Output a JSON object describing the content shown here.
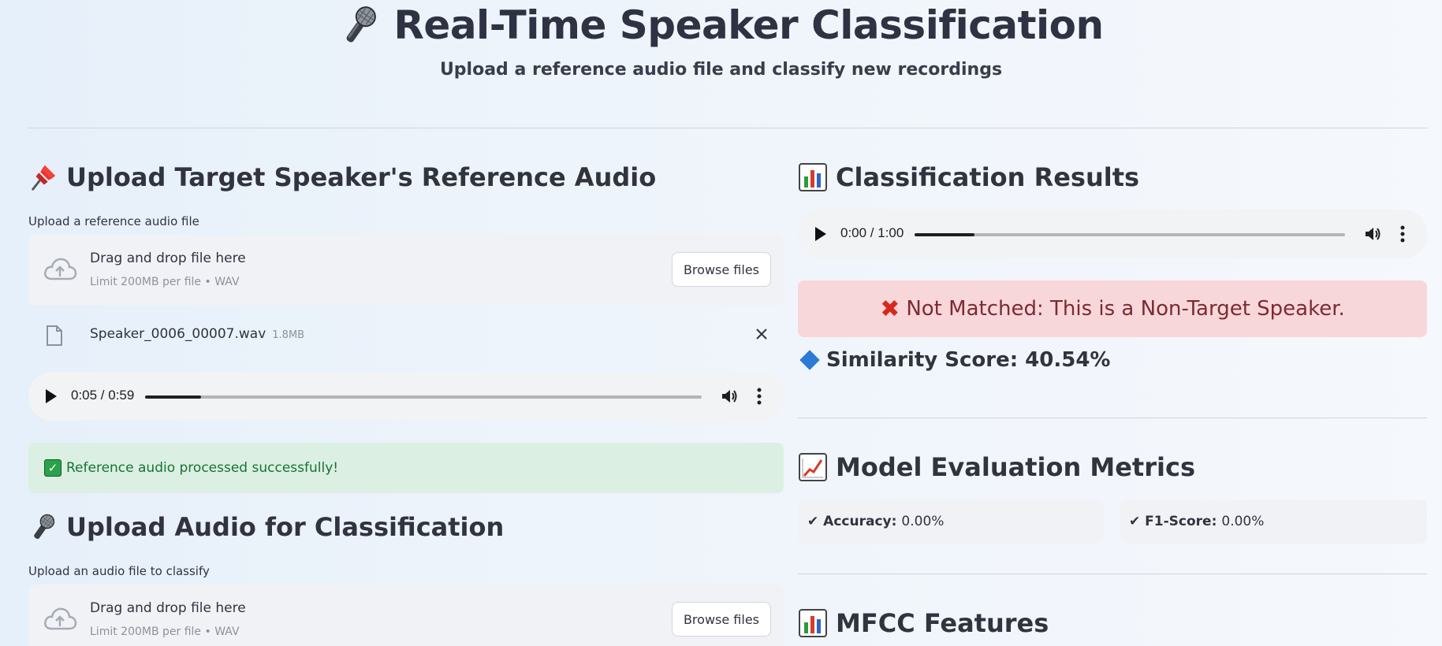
{
  "header": {
    "title": "Real-Time Speaker Classification",
    "subtitle": "Upload a reference audio file and classify new recordings"
  },
  "reference": {
    "heading": "Upload Target Speaker's Reference Audio",
    "label": "Upload a reference audio file",
    "dropzone": {
      "title": "Drag and drop file here",
      "limit": "Limit 200MB per file • WAV",
      "browse": "Browse files"
    },
    "file": {
      "name": "Speaker_0006_00007.wav",
      "size": "1.8MB"
    },
    "player": {
      "time": "0:05 / 0:59",
      "progress": 0.1
    },
    "success": "Reference audio processed successfully!"
  },
  "classify": {
    "heading": "Upload Audio for Classification",
    "label": "Upload an audio file to classify",
    "dropzone": {
      "title": "Drag and drop file here",
      "limit": "Limit 200MB per file • WAV",
      "browse": "Browse files"
    }
  },
  "results": {
    "heading": "Classification Results",
    "player": {
      "time": "0:00 / 1:00",
      "progress": 0.14
    },
    "verdict": "Not Matched: This is a Non-Target Speaker.",
    "similarity": "Similarity Score: 40.54%"
  },
  "metrics": {
    "heading": "Model Evaluation Metrics",
    "accuracy": {
      "label": "Accuracy:",
      "value": "0.00%"
    },
    "f1": {
      "label": "F1-Score:",
      "value": "0.00%"
    }
  },
  "mfcc": {
    "heading": "MFCC Features"
  },
  "colors": {
    "success_bg": "#dbf0e3",
    "error_bg": "#f8d7da",
    "panel_bg": "#f0f2f6",
    "text": "#31333f"
  }
}
